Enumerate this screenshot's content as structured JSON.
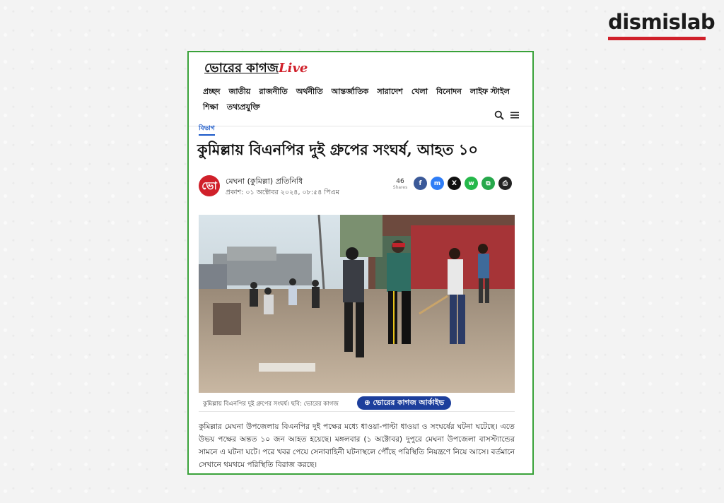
{
  "brand": {
    "name": "dismislab",
    "bar_color": "#d0202a"
  },
  "site": {
    "logo_main": "ভোরের কাগজ",
    "logo_live": "Live",
    "nav": [
      "প্রচ্ছদ",
      "জাতীয়",
      "রাজনীতি",
      "অর্থনীতি",
      "আন্তর্জাতিক",
      "সারাদেশ",
      "খেলা",
      "বিনোদন",
      "লাইফ স্টাইল",
      "শিক্ষা",
      "তথ্যপ্রযুক্তি"
    ],
    "tools": [
      "search-icon",
      "menu-icon"
    ]
  },
  "article": {
    "category": "বিভাগ",
    "headline": "কুমিল্লায় বিএনপির দুই গ্রুপের সংঘর্ষ, আহত ১০",
    "author_logo_text": "ভো",
    "author": "মেঘনা (কুমিল্লা) প্রতিনিধি",
    "published": "প্রকাশ: ০১ অক্টোবর ২০২৪, ০৮:৫৪ পিএম",
    "share_count": "46",
    "share_label": "Shares",
    "share_buttons": [
      {
        "label": "f",
        "icon": "facebook-icon",
        "color": "#3b5998"
      },
      {
        "label": "m",
        "icon": "messenger-icon",
        "color": "#2f7df6"
      },
      {
        "label": "X",
        "icon": "x-icon",
        "color": "#111111"
      },
      {
        "label": "w",
        "icon": "whatsapp-icon",
        "color": "#25b84a"
      },
      {
        "label": "⧉",
        "icon": "copy-icon",
        "color": "#27a84b"
      },
      {
        "label": "⎙",
        "icon": "print-icon",
        "color": "#222222"
      }
    ],
    "caption": "কুমিল্লায় বিএনপির দুই গ্রুপের সংঘর্ষ। ছবি: ভোরের কাগজ",
    "archive_badge": "⊕ ভোরের কাগজ আর্কাইভ",
    "body": "কুমিল্লার মেঘনা উপজেলায় বিএনপির দুই পক্ষের মধ্যে ধাওয়া-পাল্টা ধাওয়া ও সংঘর্ষের ঘটনা ঘটেছে। এতে উভয় পক্ষের অন্তত ১০ জন আহত হয়েছে। মঙ্গলবার (১ অক্টোবর) দুপুরে মেঘনা উপজেলা বাসস্ট্যান্ডের সামনে এ ঘটনা ঘটে। পরে খবর পেয়ে সেনাবাহিনী ঘটনাস্থলে পৌঁছে পরিস্থিতি নিয়ন্ত্রণে নিয়ে আসে। বর্তমানে সেখানে থমথমে পরিস্থিতি বিরাজ করছে।"
  },
  "colors": {
    "frame": "#3aa23a",
    "accent_red": "#d0202a",
    "archive_blue": "#1d3f9c"
  }
}
